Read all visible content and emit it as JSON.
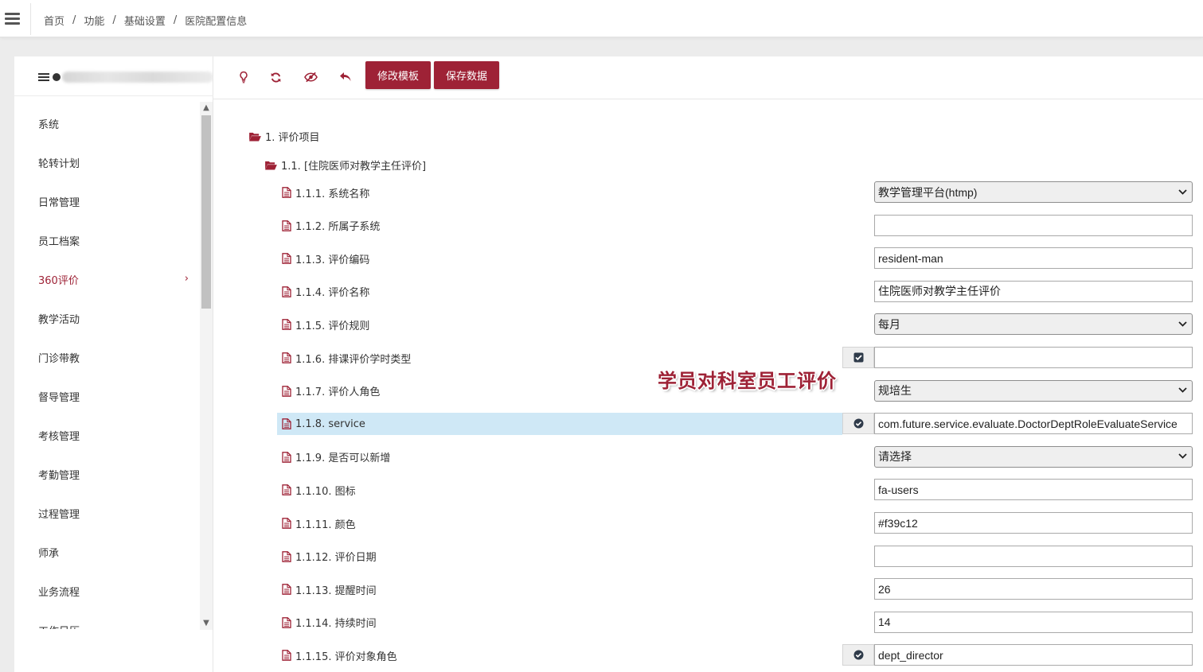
{
  "breadcrumb": [
    "首页",
    "功能",
    "基础设置",
    "医院配置信息"
  ],
  "breadcrumb_sep": "/",
  "sidebar": {
    "items": [
      {
        "label": "系统"
      },
      {
        "label": "轮转计划"
      },
      {
        "label": "日常管理"
      },
      {
        "label": "员工档案"
      },
      {
        "label": "360评价",
        "active": true,
        "chevron": "›"
      },
      {
        "label": "教学活动"
      },
      {
        "label": "门诊带教"
      },
      {
        "label": "督导管理"
      },
      {
        "label": "考核管理"
      },
      {
        "label": "考勤管理"
      },
      {
        "label": "过程管理"
      },
      {
        "label": "师承"
      },
      {
        "label": "业务流程"
      },
      {
        "label": "工作日历"
      }
    ],
    "scroll_up": "▲",
    "scroll_down": "▼"
  },
  "toolbar": {
    "icons": [
      "lightbulb-icon",
      "refresh-icon",
      "eye-slash-icon",
      "undo-icon"
    ],
    "modify_template_label": "修改模板",
    "save_data_label": "保存数据"
  },
  "tree": {
    "level1": "1. 评价项目",
    "level2": "1.1. [住院医师对教学主任评价]",
    "rows": [
      {
        "label": "1.1.1. 系统名称",
        "type": "select",
        "value": "教学管理平台(htmp)"
      },
      {
        "label": "1.1.2. 所属子系统",
        "type": "input",
        "value": ""
      },
      {
        "label": "1.1.3. 评价编码",
        "type": "input",
        "value": "resident-man"
      },
      {
        "label": "1.1.4. 评价名称",
        "type": "input",
        "value": "住院医师对教学主任评价"
      },
      {
        "label": "1.1.5. 评价规则",
        "type": "select",
        "value": "每月"
      },
      {
        "label": "1.1.6. 排课评价学时类型",
        "type": "input",
        "value": "",
        "addon": "check-square-icon"
      },
      {
        "label": "1.1.7. 评价人角色",
        "type": "select",
        "value": "规培生"
      },
      {
        "label": "1.1.8. service",
        "type": "input",
        "value": "com.future.service.evaluate.DoctorDeptRoleEvaluateService",
        "addon": "check-circle-icon",
        "highlight": true
      },
      {
        "label": "1.1.9. 是否可以新增",
        "type": "select",
        "value": "请选择"
      },
      {
        "label": "1.1.10. 图标",
        "type": "input",
        "value": "fa-users"
      },
      {
        "label": "1.1.11. 颜色",
        "type": "input",
        "value": "#f39c12"
      },
      {
        "label": "1.1.12. 评价日期",
        "type": "input",
        "value": ""
      },
      {
        "label": "1.1.13. 提醒时间",
        "type": "input",
        "value": "26"
      },
      {
        "label": "1.1.14. 持续时间",
        "type": "input",
        "value": "14"
      },
      {
        "label": "1.1.15. 评价对象角色",
        "type": "input",
        "value": "dept_director",
        "addon": "check-circle-icon"
      }
    ],
    "select_arrow": "⌄"
  },
  "annotation": "学员对科室员工评价",
  "colors": {
    "accent": "#9e2236",
    "highlight": "#cfe8f6"
  }
}
